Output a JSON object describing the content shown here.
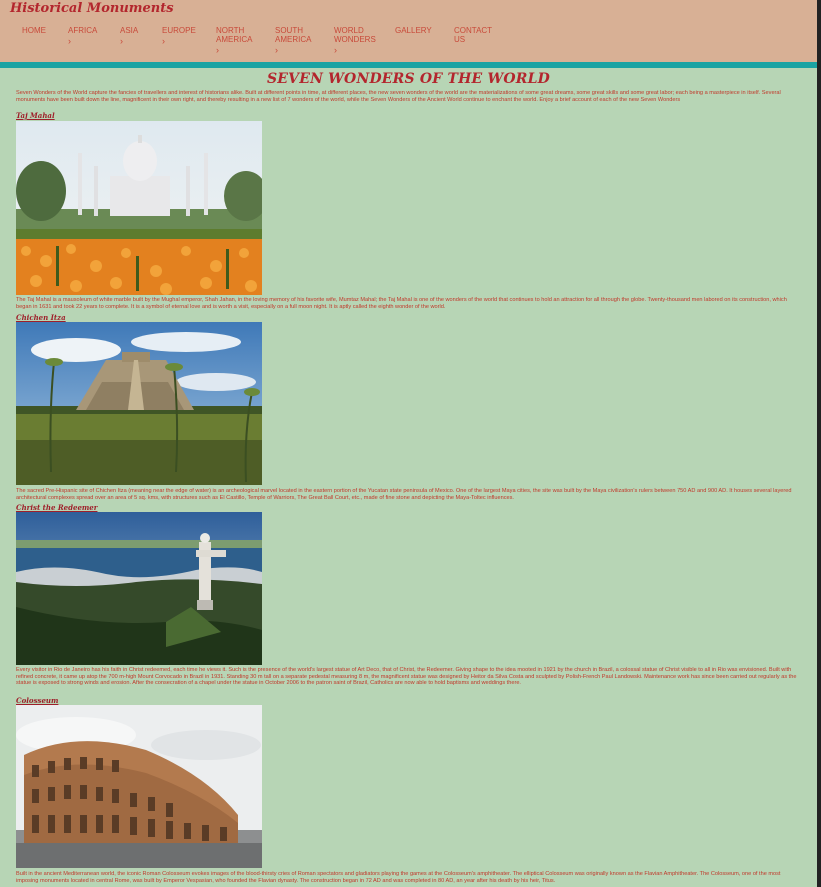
{
  "site": {
    "logo": "Historical Monuments"
  },
  "nav": {
    "items": [
      {
        "label": "HOME",
        "chevron": ""
      },
      {
        "label": "AFRICA",
        "chevron": "›"
      },
      {
        "label": "ASIA",
        "chevron": "›"
      },
      {
        "label": "EUROPE",
        "chevron": "›"
      },
      {
        "label": "NORTH AMERICA",
        "chevron": "›"
      },
      {
        "label": "SOUTH AMERICA",
        "chevron": "›"
      },
      {
        "label": "WORLD WONDERS",
        "chevron": "›"
      },
      {
        "label": "GALLERY",
        "chevron": ""
      },
      {
        "label": "CONTACT US",
        "chevron": ""
      }
    ]
  },
  "page": {
    "title": "SEVEN WONDERS OF THE WORLD",
    "intro": "Seven Wonders of the World capture the fancies of travellers and interest of historians alike. Built at different points in time, at different places, the new seven wonders of the world are the materializations of some great dreams, some great skills and some great labor; each being a masterpiece in itself. Several monuments have been built down the line, magnificent in their own right, and thereby resulting in a new list of 7 wonders of the world, while the Seven Wonders of the Ancient World continue to enchant the world. Enjoy a brief account of each of the new Seven Wonders"
  },
  "sections": [
    {
      "title": "Taj Mahal",
      "image": "taj-mahal-photo",
      "description": "The Taj Mahal is a mausoleum of white marble built by the Mughal emperor, Shah Jahan, in the loving memory of his favorite wife, Mumtaz Mahal; the Taj Mahal is one of the wonders of the world that continues to hold an attraction for all through the globe. Twenty-thousand men labored on its construction, which began in 1631 and took 22 years to complete. It is a symbol of eternal love and is worth a visit, especially on a full moon night. It is aptly called the eighth wonder of the world."
    },
    {
      "title": "Chichen Itza",
      "image": "chichen-itza-photo",
      "description": "The sacred Pre-Hispanic site of Chichen Itza (meaning near the edge of water) is an archeological marvel located in the eastern portion of the Yucatan state peninsula of Mexico. One of the largest Maya cities, the site was built by the Maya civilization's rulers between 750 AD and 900 AD. It houses several layered architectural complexes spread over an area of 5 sq. kms, with structures such as El Castillo, Temple of Warriors, The Great Ball Court, etc., made of fine stone and depicting the Maya-Toltec influences."
    },
    {
      "title": "Christ the Redeemer",
      "image": "christ-the-redeemer-photo",
      "description": "Every visitor in Rio de Janeiro has his faith in Christ redeemed, each time he views it. Such is the presence of the world's largest statue of Art Deco, that of Christ, the Redeemer. Giving shape to the idea mooted in 1921 by the church in Brazil, a colossal statue of Christ visible to all in Rio was envisioned. Built with refined concrete, it came up atop the 700 m-high Mount Corvocado in Brazil in 1931. Standing 30 m tall on a separate pedestal measuring 8 m, the magnificent statue was designed by Heitor da Silva Costa and sculpted by Polish-French Paul Landowski. Maintenance work has since been carried out regularly as the statue is exposed to strong winds and erosion. After the consecration of a chapel under the statue in October 2006 to the patron saint of Brazil, Catholics are now able to hold baptisms and weddings there."
    },
    {
      "title": "Colosseum",
      "image": "colosseum-photo",
      "description": "Built in the ancient Mediterranean world, the iconic Roman Colosseum evokes images of the blood-thirsty cries of Roman spectators and gladiators playing the games at the Colosseum's amphitheater. The elliptical Colosseum was originally known as the Flavian Amphitheater. The Colosseum, one of the most imposing monuments located in central Rome, was built by Emperor Vespasian, who founded the Flavian dynasty. The construction began in 72 AD and was completed in 80 AD, an year after his death by his heir, Titus."
    }
  ]
}
